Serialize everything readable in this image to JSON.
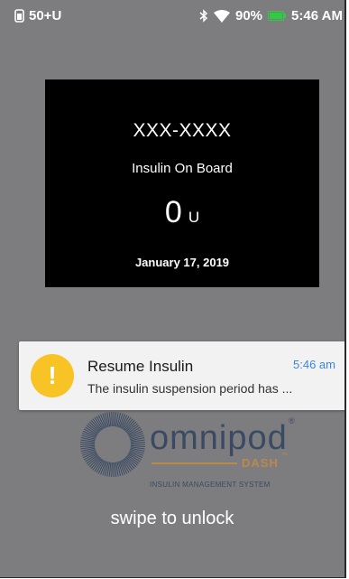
{
  "statusbar": {
    "left_icon": "insulin-on-board-icon",
    "left_text": "50+U",
    "icons": [
      "bluetooth-icon",
      "wifi-icon",
      "battery-icon"
    ],
    "battery_text": "90%",
    "battery_color": "#2ecc40",
    "time": "5:46 AM"
  },
  "lock_card": {
    "id": "XXX-XXXX",
    "label": "Insulin On Board",
    "value": "0",
    "unit": "U",
    "date": "January 17, 2019"
  },
  "notification": {
    "icon": "warning-icon",
    "icon_symbol": "!",
    "icon_color": "#f7c325",
    "title": "Resume Insulin",
    "time": "5:46 am",
    "time_color": "#3d86d9",
    "body": "The insulin suspension period has ..."
  },
  "logo": {
    "icon": "omnipod-ring-icon",
    "wordmark": "omnipod",
    "registered": "®",
    "submark": "DASH",
    "trademark": "™",
    "tagline": "INSULIN MANAGEMENT SYSTEM"
  },
  "unlock": {
    "text": "swipe to unlock"
  },
  "colors": {
    "background": "#7d7d7f",
    "card": "#000000",
    "notification_bg": "#f2f2f2",
    "logo_primary": "#3a4a63",
    "logo_accent": "#b98a4a"
  }
}
